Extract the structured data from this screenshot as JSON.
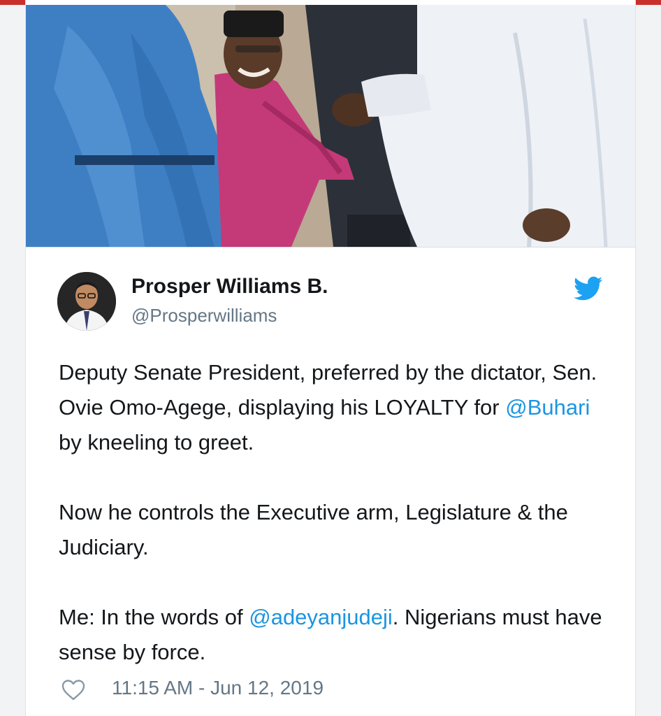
{
  "colors": {
    "top_bar": "#c9302c",
    "mention": "#1b95e0",
    "name": "#14171a",
    "muted": "#657786",
    "twitter_blue": "#1da1f2"
  },
  "photo": {
    "icon": "photo"
  },
  "tweet": {
    "author": {
      "name": "Prosper Williams B.",
      "handle": "@Prosperwilliams",
      "avatar_icon": "avatar"
    },
    "brand_icon": "twitter-bird-icon",
    "paragraphs": [
      {
        "segments": [
          {
            "text": "Deputy Senate President, preferred by the dictator, Sen. Ovie Omo-Agege, displaying his LOYALTY for ",
            "mention": false
          },
          {
            "text": "@Buhari",
            "mention": true
          },
          {
            "text": " by kneeling to greet.",
            "mention": false
          }
        ]
      },
      {
        "segments": [
          {
            "text": "Now he controls the Executive arm, Legislature & the Judiciary.",
            "mention": false
          }
        ]
      },
      {
        "segments": [
          {
            "text": "Me: In the words of ",
            "mention": false
          },
          {
            "text": "@adeyanjudeji",
            "mention": true
          },
          {
            "text": ". Nigerians must have sense by force.",
            "mention": false
          }
        ]
      }
    ],
    "footer": {
      "like_icon": "heart-icon",
      "timestamp": "11:15 AM - Jun 12, 2019"
    }
  }
}
